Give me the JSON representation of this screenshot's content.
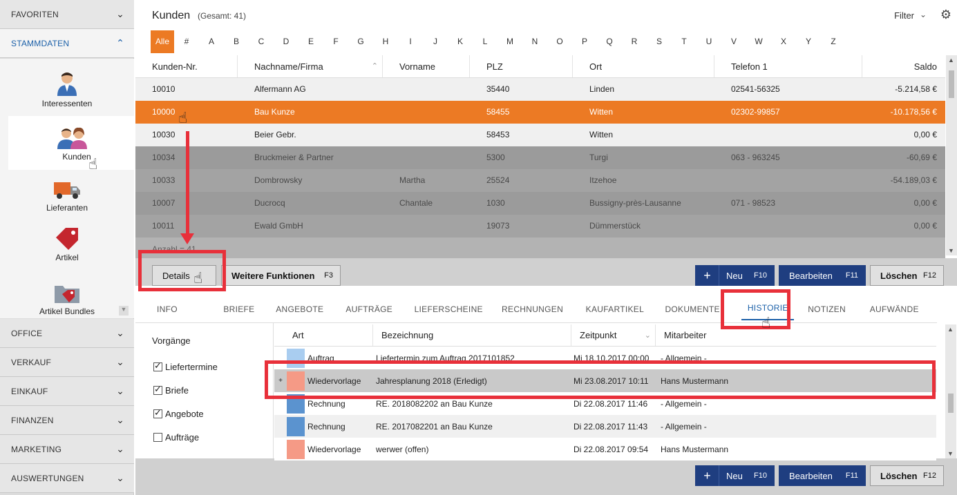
{
  "sidebar": {
    "favoriten": "FAVORITEN",
    "stammdaten": "STAMMDATEN",
    "items": [
      {
        "label": "Interessenten",
        "icon": "person-icon"
      },
      {
        "label": "Kunden",
        "icon": "customers-icon"
      },
      {
        "label": "Lieferanten",
        "icon": "truck-icon"
      },
      {
        "label": "Artikel",
        "icon": "tag-icon"
      },
      {
        "label": "Artikel Bundles",
        "icon": "folder-tag-icon"
      }
    ],
    "sections": [
      "OFFICE",
      "VERKAUF",
      "EINKAUF",
      "FINANZEN",
      "MARKETING",
      "AUSWERTUNGEN"
    ]
  },
  "header": {
    "title": "Kunden",
    "total": "(Gesamt: 41)",
    "filter": "Filter"
  },
  "alphabet": [
    "Alle",
    "#",
    "A",
    "B",
    "C",
    "D",
    "E",
    "F",
    "G",
    "H",
    "I",
    "J",
    "K",
    "L",
    "M",
    "N",
    "O",
    "P",
    "Q",
    "R",
    "S",
    "T",
    "U",
    "V",
    "W",
    "X",
    "Y",
    "Z"
  ],
  "customers": {
    "columns": [
      "Kunden-Nr.",
      "Nachname/Firma",
      "Vorname",
      "PLZ",
      "Ort",
      "Telefon 1",
      "Saldo"
    ],
    "rows": [
      [
        "10010",
        "Alfermann AG",
        "",
        "35440",
        "Linden",
        "02541-56325",
        "-5.214,58 €"
      ],
      [
        "10000",
        "Bau Kunze",
        "",
        "58455",
        "Witten",
        "02302-99857",
        "-10.178,56 €"
      ],
      [
        "10030",
        "Beier Gebr.",
        "",
        "58453",
        "Witten",
        "",
        "0,00 €"
      ],
      [
        "10034",
        "Bruckmeier & Partner",
        "",
        "5300",
        "Turgi",
        "063 - 963245",
        "-60,69 €"
      ],
      [
        "10033",
        "Dombrowsky",
        "Martha",
        "25524",
        "Itzehoe",
        "",
        "-54.189,03 €"
      ],
      [
        "10007",
        "Ducrocq",
        "Chantale",
        "1030",
        "Bussigny-près-Lausanne",
        "071 - 98523",
        "0,00 €"
      ],
      [
        "10011",
        "Ewald GmbH",
        "",
        "19073",
        "Dümmerstück",
        "",
        "0,00 €"
      ]
    ],
    "count": "Anzahl = 41"
  },
  "actions": {
    "details": "Details",
    "weitere": "Weitere Funktionen",
    "weitere_key": "F3",
    "neu": "Neu",
    "neu_key": "F10",
    "bearbeiten": "Bearbeiten",
    "bearbeiten_key": "F11",
    "loeschen": "Löschen",
    "loeschen_key": "F12"
  },
  "tabs": [
    "INFO",
    "BRIEFE",
    "ANGEBOTE",
    "AUFTRÄGE",
    "LIEFERSCHEINE",
    "RECHNUNGEN",
    "KAUFARTIKEL",
    "DOKUMENTE",
    "HISTORIE",
    "NOTIZEN",
    "AUFWÄNDE"
  ],
  "vorgaenge": {
    "title": "Vorgänge",
    "items": [
      {
        "label": "Liefertermine",
        "checked": true
      },
      {
        "label": "Briefe",
        "checked": true
      },
      {
        "label": "Angebote",
        "checked": true
      },
      {
        "label": "Aufträge",
        "checked": false
      }
    ]
  },
  "history": {
    "columns": [
      "Art",
      "Bezeichnung",
      "Zeitpunkt",
      "Mitarbeiter"
    ],
    "rows": [
      {
        "color": "#a9cdf0",
        "art": "Auftrag",
        "bez": "Liefertermin zum Auftrag 2017101852",
        "zeit": "Mi 18.10.2017 00:00",
        "mit": "- Allgemein -"
      },
      {
        "color": "#f59a86",
        "art": "Wiedervorlage",
        "bez": "Jahresplanung 2018 (Erledigt)",
        "zeit": "Mi 23.08.2017 10:11",
        "mit": "Hans Mustermann",
        "expand": "+"
      },
      {
        "color": "#5b93cf",
        "art": "Rechnung",
        "bez": "RE. 2018082202 an Bau Kunze",
        "zeit": "Di 22.08.2017 11:46",
        "mit": "- Allgemein -"
      },
      {
        "color": "#5b93cf",
        "art": "Rechnung",
        "bez": "RE. 2017082201 an Bau Kunze",
        "zeit": "Di 22.08.2017 11:43",
        "mit": "- Allgemein -"
      },
      {
        "color": "#f59a86",
        "art": "Wiedervorlage",
        "bez": "werwer (offen)",
        "zeit": "Di 22.08.2017 09:54",
        "mit": "Hans Mustermann"
      }
    ]
  },
  "colors": {
    "accent": "#ec7a24",
    "primary": "#1f3e80",
    "link": "#1a5fa8",
    "annotation": "#e8303a"
  }
}
